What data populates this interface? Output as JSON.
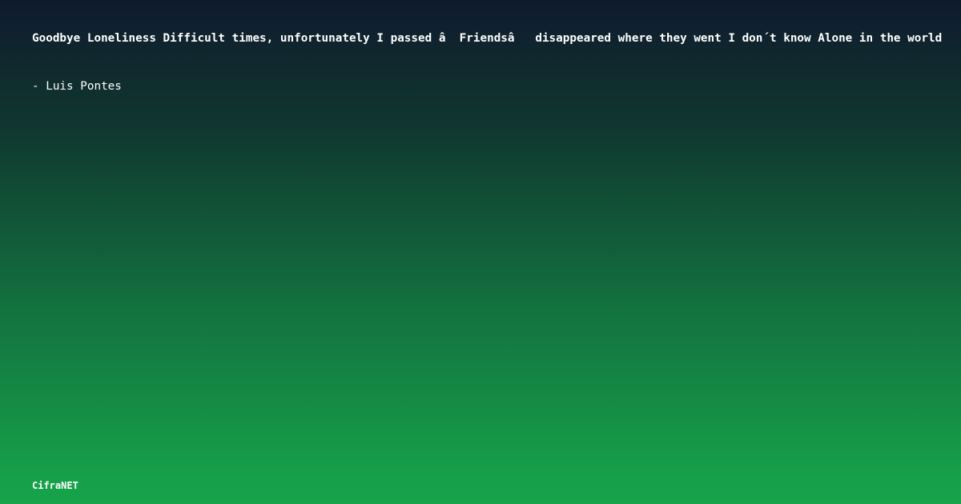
{
  "quote": {
    "text": "Goodbye Loneliness Difficult times, unfortunately I passed â  Friendsâ   disappeared where they went I don´t know Alone in the world",
    "author": "- Luis Pontes"
  },
  "footer": {
    "brand": "CifraNET"
  }
}
